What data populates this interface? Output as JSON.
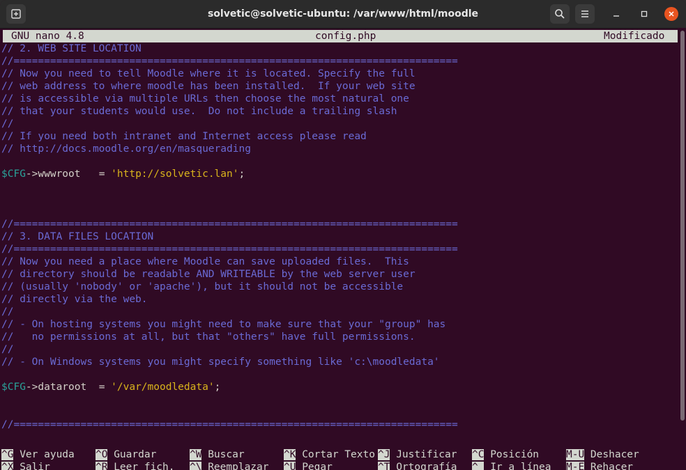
{
  "window": {
    "title": "solvetic@solvetic-ubuntu: /var/www/html/moodle"
  },
  "nano": {
    "version": "GNU nano 4.8",
    "filename": "config.php",
    "status": "Modificado"
  },
  "lines": [
    {
      "cls": "c",
      "text": "// 2. WEB SITE LOCATION"
    },
    {
      "cls": "c",
      "text": "//========================================================================="
    },
    {
      "cls": "c",
      "text": "// Now you need to tell Moodle where it is located. Specify the full"
    },
    {
      "cls": "c",
      "text": "// web address to where moodle has been installed.  If your web site"
    },
    {
      "cls": "c",
      "text": "// is accessible via multiple URLs then choose the most natural one"
    },
    {
      "cls": "c",
      "text": "// that your students would use.  Do not include a trailing slash"
    },
    {
      "cls": "c",
      "text": "//"
    },
    {
      "cls": "c",
      "text": "// If you need both intranet and Internet access please read"
    },
    {
      "cls": "c",
      "text": "// http://docs.moodle.org/en/masquerading"
    },
    {
      "cls": "",
      "text": ""
    },
    {
      "cls": "code",
      "var": "$CFG",
      "arrow": "->",
      "prop": "wwwroot   = ",
      "str": "'http://solvetic.lan'",
      "end": ";"
    },
    {
      "cls": "",
      "text": ""
    },
    {
      "cls": "",
      "text": ""
    },
    {
      "cls": "",
      "text": ""
    },
    {
      "cls": "c",
      "text": "//========================================================================="
    },
    {
      "cls": "c",
      "text": "// 3. DATA FILES LOCATION"
    },
    {
      "cls": "c",
      "text": "//========================================================================="
    },
    {
      "cls": "c",
      "text": "// Now you need a place where Moodle can save uploaded files.  This"
    },
    {
      "cls": "c",
      "text": "// directory should be readable AND WRITEABLE by the web server user"
    },
    {
      "cls": "c",
      "text": "// (usually 'nobody' or 'apache'), but it should not be accessible"
    },
    {
      "cls": "c",
      "text": "// directly via the web."
    },
    {
      "cls": "c",
      "text": "//"
    },
    {
      "cls": "c",
      "text": "// - On hosting systems you might need to make sure that your \"group\" has"
    },
    {
      "cls": "c",
      "text": "//   no permissions at all, but that \"others\" have full permissions."
    },
    {
      "cls": "c",
      "text": "//"
    },
    {
      "cls": "c",
      "text": "// - On Windows systems you might specify something like 'c:\\moodledata'"
    },
    {
      "cls": "",
      "text": ""
    },
    {
      "cls": "code",
      "var": "$CFG",
      "arrow": "->",
      "prop": "dataroot  = ",
      "str": "'/var/moodledata'",
      "end": ";"
    },
    {
      "cls": "",
      "text": ""
    },
    {
      "cls": "",
      "text": ""
    },
    {
      "cls": "c",
      "text": "//========================================================================="
    }
  ],
  "shortcuts": {
    "row1": [
      {
        "key": "^G",
        "label": "Ver ayuda"
      },
      {
        "key": "^O",
        "label": "Guardar"
      },
      {
        "key": "^W",
        "label": "Buscar"
      },
      {
        "key": "^K",
        "label": "Cortar Texto"
      },
      {
        "key": "^J",
        "label": "Justificar"
      },
      {
        "key": "^C",
        "label": "Posición"
      },
      {
        "key": "M-U",
        "label": "Deshacer"
      }
    ],
    "row2": [
      {
        "key": "^X",
        "label": "Salir"
      },
      {
        "key": "^R",
        "label": "Leer fich."
      },
      {
        "key": "^\\",
        "label": "Reemplazar"
      },
      {
        "key": "^U",
        "label": "Pegar"
      },
      {
        "key": "^T",
        "label": "Ortografía"
      },
      {
        "key": "^_",
        "label": "Ir a línea"
      },
      {
        "key": "M-E",
        "label": "Rehacer"
      }
    ]
  },
  "colors": {
    "terminal_bg": "#300a24",
    "comment": "#6a6ad4",
    "string": "#d9b41c",
    "variable": "#2aa198",
    "close_button": "#e95420"
  },
  "icons": [
    "new-tab-icon",
    "search-icon",
    "hamburger-menu-icon",
    "minimize-icon",
    "maximize-icon",
    "close-icon"
  ]
}
